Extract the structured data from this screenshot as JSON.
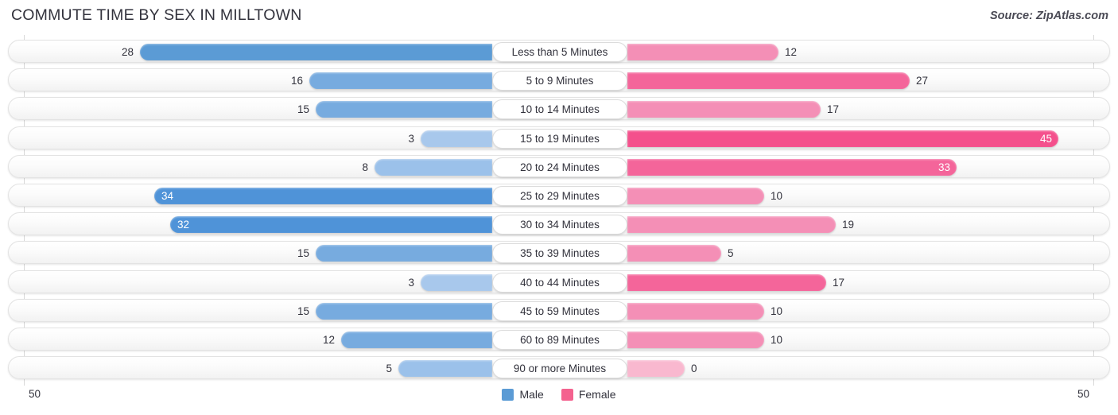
{
  "header": {
    "title": "COMMUTE TIME BY SEX IN MILLTOWN",
    "source": "Source: ZipAtlas.com"
  },
  "axis": {
    "left_tick": "50",
    "right_tick": "50"
  },
  "legend": {
    "items": [
      {
        "label": "Male",
        "color": "#5b9bd5"
      },
      {
        "label": "Female",
        "color": "#f4628f"
      }
    ]
  },
  "colors": {
    "male_strong": "#4f93d8",
    "male_mid": "#72a8de",
    "male_light": "#a8c8ec",
    "female_strongest": "#f4508c",
    "female_strong": "#f4659a",
    "female_mid": "#f48fb6",
    "female_light": "#f9b8cf",
    "track_border": "#e3e3e3",
    "axis_line": "#d8d8d8"
  },
  "chart_data": {
    "type": "bar",
    "title": "COMMUTE TIME BY SEX IN MILLTOWN",
    "subtitle": "",
    "xlabel": "",
    "ylabel": "",
    "orientation": "horizontal-diverging",
    "xlim": [
      50,
      50
    ],
    "grid": false,
    "legend_position": "bottom-center",
    "categories": [
      "Less than 5 Minutes",
      "5 to 9 Minutes",
      "10 to 14 Minutes",
      "15 to 19 Minutes",
      "20 to 24 Minutes",
      "25 to 29 Minutes",
      "30 to 34 Minutes",
      "35 to 39 Minutes",
      "40 to 44 Minutes",
      "45 to 59 Minutes",
      "60 to 89 Minutes",
      "90 or more Minutes"
    ],
    "series": [
      {
        "name": "Male",
        "side": "left",
        "values": [
          28,
          16,
          15,
          3,
          8,
          34,
          32,
          15,
          3,
          15,
          12,
          5
        ]
      },
      {
        "name": "Female",
        "side": "right",
        "values": [
          12,
          27,
          17,
          45,
          33,
          10,
          19,
          5,
          17,
          10,
          10,
          0
        ]
      }
    ]
  },
  "rows": [
    {
      "label": "Less than 5 Minutes",
      "male": "28",
      "female": "12",
      "male_w": 443,
      "female_w": 190,
      "male_color": "#5b9bd5",
      "female_color": "#f48fb6",
      "male_inside": false,
      "female_inside": false
    },
    {
      "label": "5 to 9 Minutes",
      "male": "16",
      "female": "27",
      "male_w": 230,
      "female_w": 355,
      "male_color": "#77abdf",
      "female_color": "#f4659a",
      "male_inside": false,
      "female_inside": false
    },
    {
      "label": "10 to 14 Minutes",
      "male": "15",
      "female": "17",
      "male_w": 222,
      "female_w": 243,
      "male_color": "#77abdf",
      "female_color": "#f48fb6",
      "male_inside": false,
      "female_inside": false
    },
    {
      "label": "15 to 19 Minutes",
      "male": "3",
      "female": "45",
      "male_w": 90,
      "female_w": 542,
      "male_color": "#a8c8ec",
      "female_color": "#f4508c",
      "male_inside": false,
      "female_inside": true
    },
    {
      "label": "20 to 24 Minutes",
      "male": "8",
      "female": "33",
      "male_w": 148,
      "female_w": 414,
      "male_color": "#9bc1ea",
      "female_color": "#f4659a",
      "male_inside": false,
      "female_inside": true
    },
    {
      "label": "25 to 29 Minutes",
      "male": "34",
      "female": "10",
      "male_w": 425,
      "female_w": 172,
      "male_color": "#4f93d8",
      "female_color": "#f48fb6",
      "male_inside": true,
      "female_inside": false
    },
    {
      "label": "30 to 34 Minutes",
      "male": "32",
      "female": "19",
      "male_w": 405,
      "female_w": 262,
      "male_color": "#4f93d8",
      "female_color": "#f48fb6",
      "male_inside": true,
      "female_inside": false
    },
    {
      "label": "35 to 39 Minutes",
      "male": "15",
      "female": "5",
      "male_w": 222,
      "female_w": 118,
      "male_color": "#77abdf",
      "female_color": "#f48fb6",
      "male_inside": false,
      "female_inside": false
    },
    {
      "label": "40 to 44 Minutes",
      "male": "3",
      "female": "17",
      "male_w": 90,
      "female_w": 250,
      "male_color": "#a8c8ec",
      "female_color": "#f4659a",
      "male_inside": false,
      "female_inside": false
    },
    {
      "label": "45 to 59 Minutes",
      "male": "15",
      "female": "10",
      "male_w": 222,
      "female_w": 172,
      "male_color": "#77abdf",
      "female_color": "#f48fb6",
      "male_inside": false,
      "female_inside": false
    },
    {
      "label": "60 to 89 Minutes",
      "male": "12",
      "female": "10",
      "male_w": 190,
      "female_w": 172,
      "male_color": "#77abdf",
      "female_color": "#f48fb6",
      "male_inside": false,
      "female_inside": false
    },
    {
      "label": "90 or more Minutes",
      "male": "5",
      "female": "0",
      "male_w": 118,
      "female_w": 72,
      "male_color": "#9bc1ea",
      "female_color": "#f9b8cf",
      "male_inside": false,
      "female_inside": false
    }
  ]
}
